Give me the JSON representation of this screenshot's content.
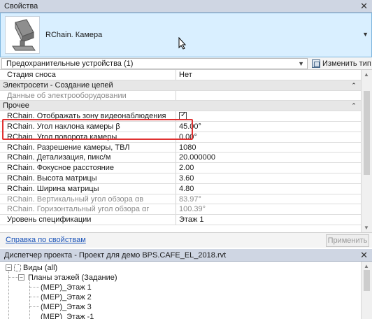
{
  "properties_panel": {
    "title": "Свойства",
    "close_glyph": "✕",
    "type_name": "RChain. Камера",
    "filter_value": "Предохранительные устройства (1)",
    "edit_type_label": "Изменить тип",
    "rows": [
      {
        "label": "Стадия сноса",
        "value": "Нет"
      }
    ],
    "group_electrical": "Электросети - Создание цепей",
    "row_electrical_data": {
      "label": "Данные об электрооборудовании",
      "value": ""
    },
    "group_other": "Прочее",
    "other_rows": [
      {
        "label": "RChain. Отображать зону видеонаблюдения",
        "value": ""
      },
      {
        "label": "RChain. Угол наклона камеры β",
        "value": "45.00°"
      },
      {
        "label": "RChain. Угол поворота камеры",
        "value": "0.00°"
      },
      {
        "label": "RChain. Разрешение камеры, ТВЛ",
        "value": "1080"
      },
      {
        "label": "RChain. Детализация, пикс/м",
        "value": "20.000000"
      },
      {
        "label": "RChain. Фокусное расстояние",
        "value": "2.00"
      },
      {
        "label": "RChain. Высота матрицы",
        "value": "3.60"
      },
      {
        "label": "RChain. Ширина матрицы",
        "value": "4.80"
      },
      {
        "label": "RChain. Вертикальный угол обзора αв",
        "value": "83.97°"
      },
      {
        "label": "RChain. Горизонтальный угол обзора αг",
        "value": "100.39°"
      },
      {
        "label": "Уровень спецификации",
        "value": "Этаж 1"
      }
    ],
    "help_link": "Справка по свойствам",
    "apply_label": "Применить"
  },
  "project_browser": {
    "title": "Диспетчер проекта - Проект для демо BPS.CAFE_EL_2018.rvt",
    "close_glyph": "✕",
    "nodes": {
      "views": "Виды (all)",
      "floor_plans": "Планы этажей (Задание)",
      "plan1": "(MEP)_Этаж 1",
      "plan2": "(MEP)_Этаж 2",
      "plan3": "(MEP)_Этаж 3",
      "plan4": "(MEP)_Этаж -1"
    }
  },
  "colors": {
    "highlight": "#e03131",
    "selection_bg": "#d9efff",
    "link": "#1a53b8"
  }
}
